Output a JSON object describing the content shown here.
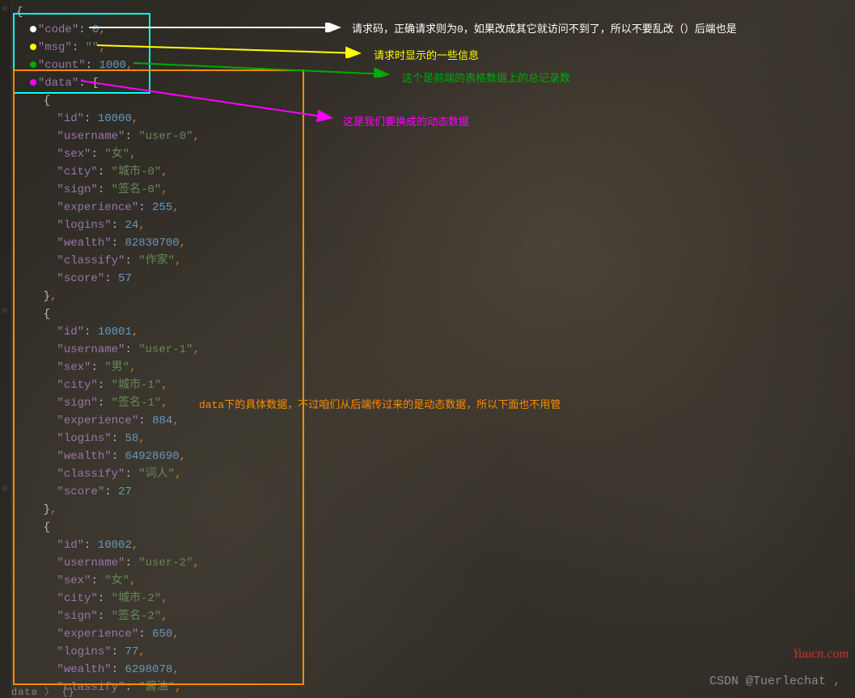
{
  "json_root": {
    "code_key": "\"code\"",
    "code_val": "0",
    "msg_key": "\"msg\"",
    "msg_val": "\"\"",
    "count_key": "\"count\"",
    "count_val": "1000",
    "data_key": "\"data\""
  },
  "records": [
    {
      "id_key": "\"id\"",
      "id_val": "10000",
      "username_key": "\"username\"",
      "username_val": "\"user-0\"",
      "sex_key": "\"sex\"",
      "sex_val": "\"女\"",
      "city_key": "\"city\"",
      "city_val": "\"城市-0\"",
      "sign_key": "\"sign\"",
      "sign_val": "\"签名-0\"",
      "experience_key": "\"experience\"",
      "experience_val": "255",
      "logins_key": "\"logins\"",
      "logins_val": "24",
      "wealth_key": "\"wealth\"",
      "wealth_val": "82830700",
      "classify_key": "\"classify\"",
      "classify_val": "\"作家\"",
      "score_key": "\"score\"",
      "score_val": "57"
    },
    {
      "id_key": "\"id\"",
      "id_val": "10001",
      "username_key": "\"username\"",
      "username_val": "\"user-1\"",
      "sex_key": "\"sex\"",
      "sex_val": "\"男\"",
      "city_key": "\"city\"",
      "city_val": "\"城市-1\"",
      "sign_key": "\"sign\"",
      "sign_val": "\"签名-1\"",
      "experience_key": "\"experience\"",
      "experience_val": "884",
      "logins_key": "\"logins\"",
      "logins_val": "58",
      "wealth_key": "\"wealth\"",
      "wealth_val": "64928690",
      "classify_key": "\"classify\"",
      "classify_val": "\"词人\"",
      "score_key": "\"score\"",
      "score_val": "27"
    },
    {
      "id_key": "\"id\"",
      "id_val": "10002",
      "username_key": "\"username\"",
      "username_val": "\"user-2\"",
      "sex_key": "\"sex\"",
      "sex_val": "\"女\"",
      "city_key": "\"city\"",
      "city_val": "\"城市-2\"",
      "sign_key": "\"sign\"",
      "sign_val": "\"签名-2\"",
      "experience_key": "\"experience\"",
      "experience_val": "650",
      "logins_key": "\"logins\"",
      "logins_val": "77",
      "wealth_key": "\"wealth\"",
      "wealth_val": "6298078",
      "classify_key": "\"classify\"",
      "classify_val": "\"酱油\""
    }
  ],
  "annotations": {
    "code_note": "请求码，正确请求则为0，如果改成其它就访问不到了，所以不要乱改（）后端也是",
    "msg_note": "请求时显示的一些信息",
    "count_note": "这个是前端的表格数据上的总记录数",
    "data_note": "这是我们要换成的动态数据",
    "body_note": "data下的具体数据，不过咱们从后端传过来的是动态数据，所以下面也不用管"
  },
  "watermarks": {
    "site": "Yuucn.com",
    "csdn": "CSDN @Tuerlechat ,"
  },
  "breadcrumb": {
    "path": "data",
    "sep": "〉",
    "item": "{}"
  }
}
